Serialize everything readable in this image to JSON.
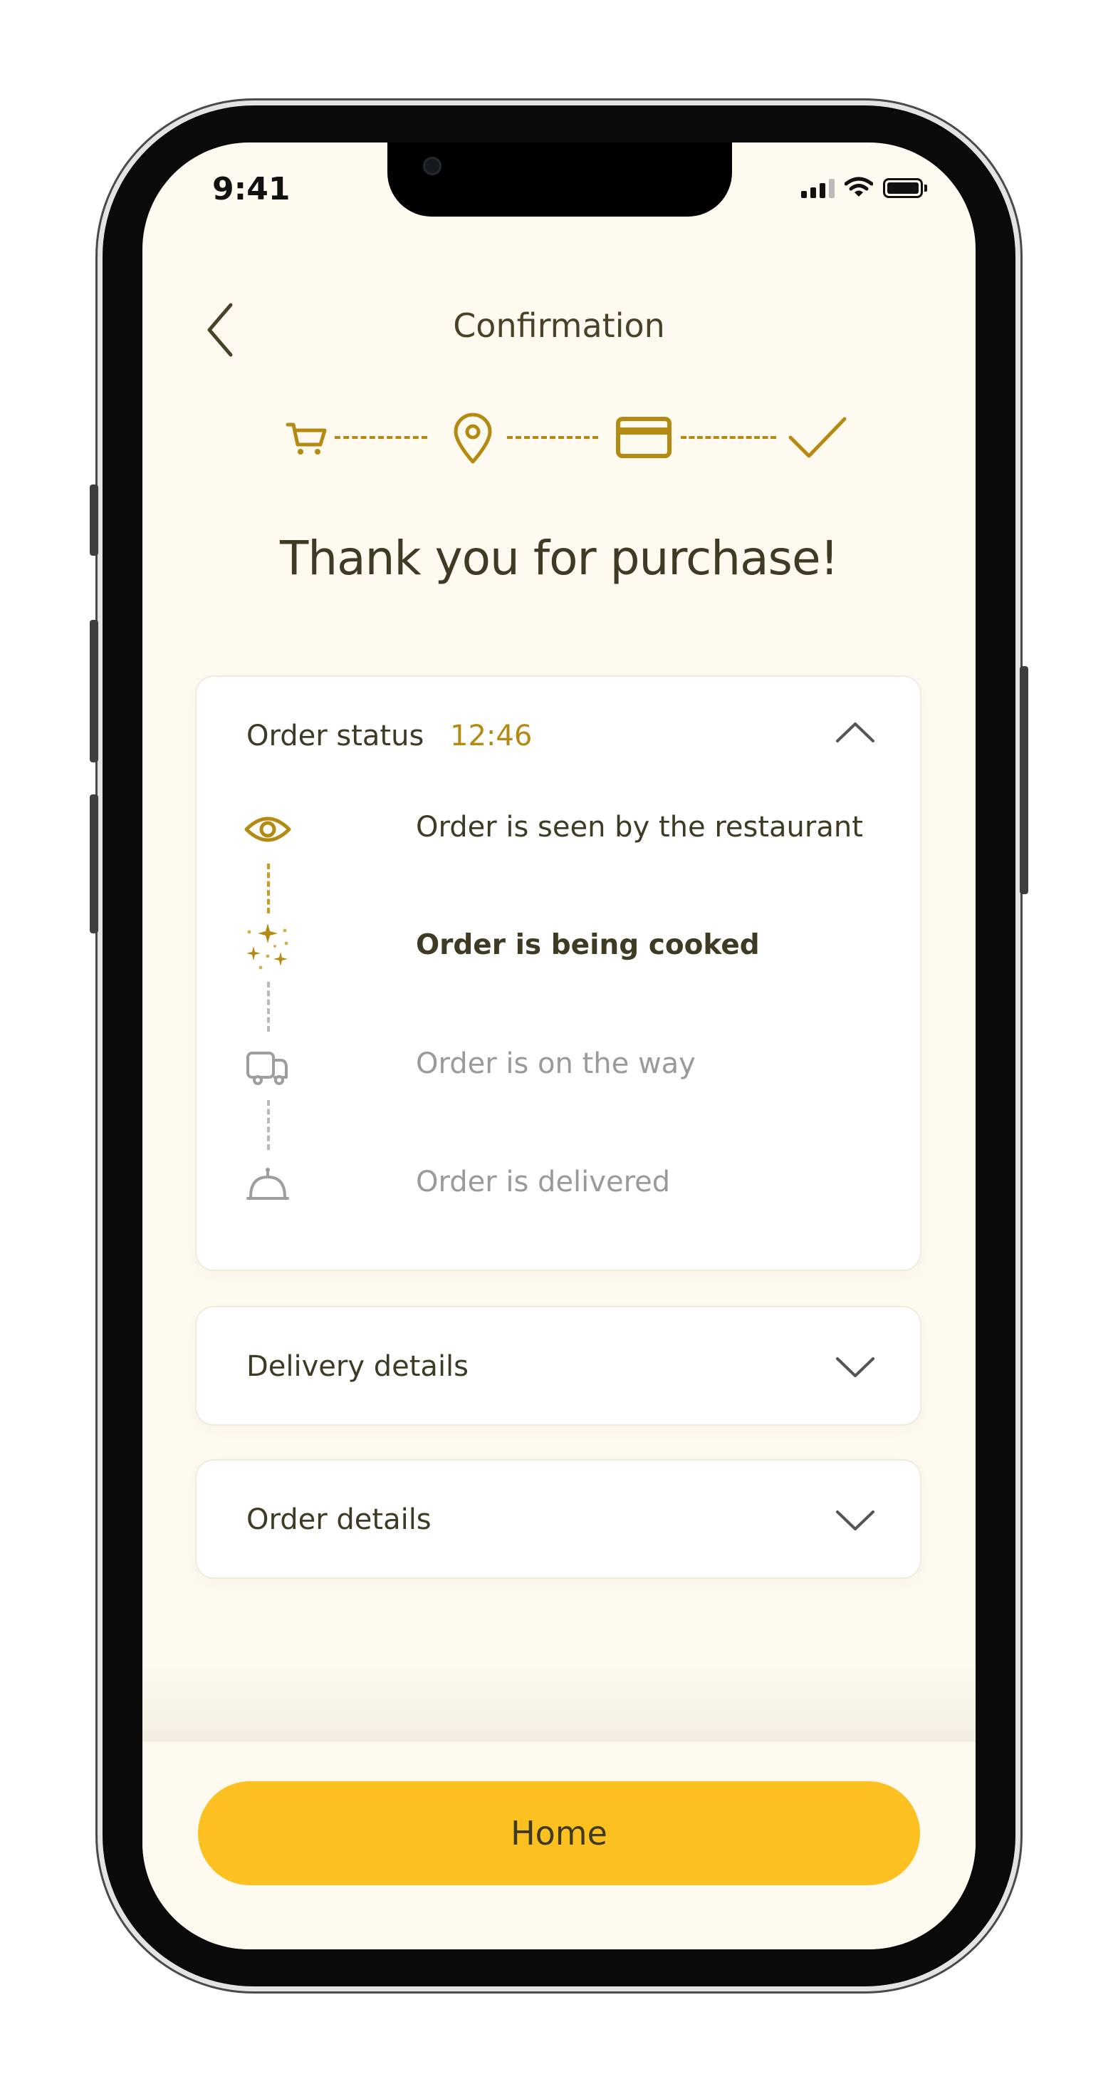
{
  "status_bar": {
    "time": "9:41"
  },
  "header": {
    "title": "Confirmation"
  },
  "progress_steps": [
    {
      "icon": "cart-icon",
      "state": "done"
    },
    {
      "icon": "location-pin-icon",
      "state": "done"
    },
    {
      "icon": "credit-card-icon",
      "state": "done"
    },
    {
      "icon": "checkmark-icon",
      "state": "done"
    }
  ],
  "headline": "Thank you for purchase!",
  "order_status": {
    "label": "Order status",
    "time": "12:46",
    "expanded": true,
    "items": [
      {
        "text": "Order is seen by the restaurant",
        "icon": "eye-icon",
        "state": "done"
      },
      {
        "text": "Order is being cooked",
        "icon": "sparkles-icon",
        "state": "active"
      },
      {
        "text": "Order is on the way",
        "icon": "delivery-truck-icon",
        "state": "pending"
      },
      {
        "text": "Order is delivered",
        "icon": "cloche-icon",
        "state": "pending"
      }
    ]
  },
  "delivery_details": {
    "label": "Delivery details",
    "expanded": false
  },
  "order_details": {
    "label": "Order details",
    "expanded": false
  },
  "home_button": {
    "label": "Home"
  },
  "colors": {
    "accent": "#b58a12",
    "button": "#fdc021",
    "background": "#fefaf0",
    "text_dark": "#3e3a23",
    "text_muted": "#9a9a9a"
  }
}
